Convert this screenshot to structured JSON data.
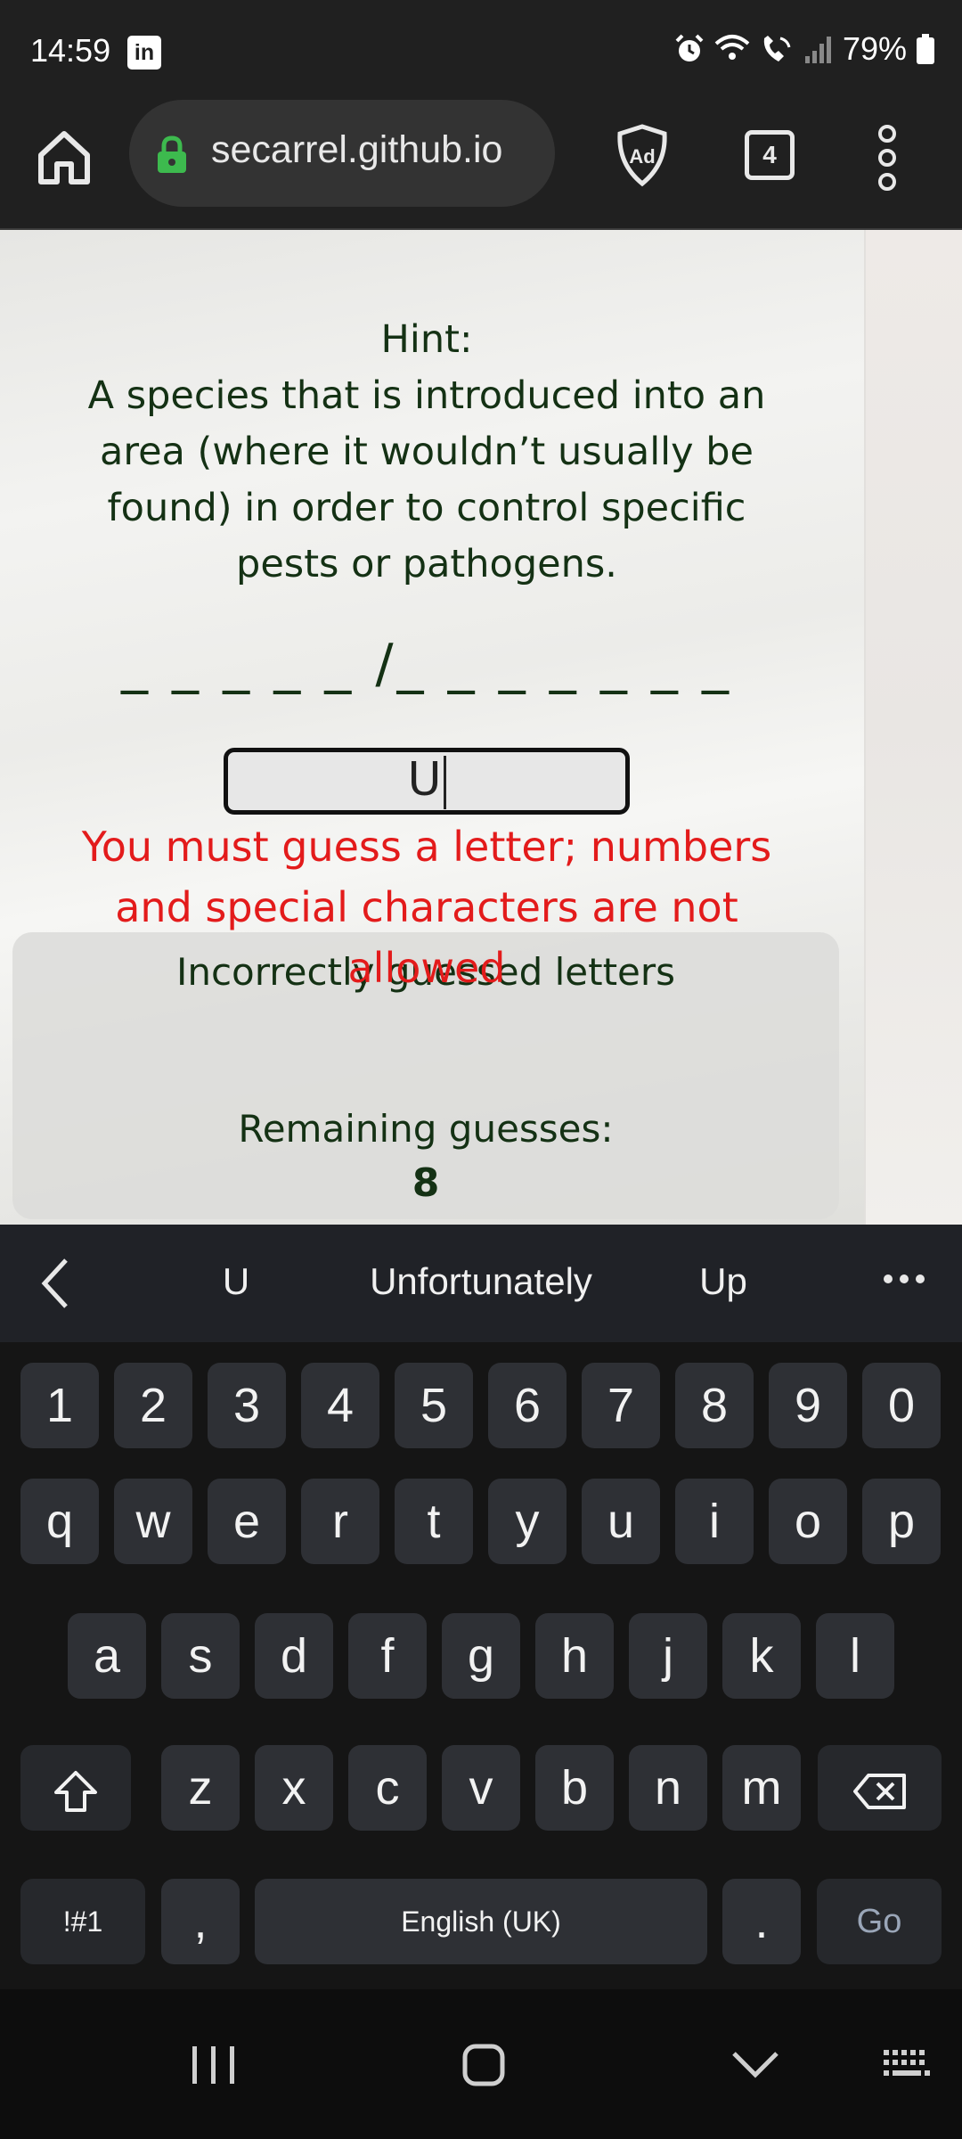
{
  "status_bar": {
    "time": "14:59",
    "battery": "79%",
    "icons": [
      "linkedin-icon",
      "alarm-icon",
      "wifi-icon",
      "wifi-calling-icon",
      "signal-icon",
      "battery-icon"
    ]
  },
  "browser": {
    "url": "secarrel.github.io",
    "tab_count": "4",
    "icons": [
      "home-icon",
      "lock-icon",
      "ad-block-icon",
      "tabs-icon",
      "more-vert-icon"
    ]
  },
  "game": {
    "hint_title": "Hint:",
    "hint_lines": [
      "A species that is introduced into an",
      "area (where it wouldn’t usually be",
      "found) in order to control specific",
      "pests or pathogens."
    ],
    "word_blanks": "_ _ _ _ _ /_ _ _ _ _ _ _",
    "input_value": "U",
    "error_lines": [
      "You must guess a letter; numbers",
      "and special characters are not",
      "allowed"
    ],
    "incorrect_label": "Incorrectly guessed letters",
    "remaining_label": "Remaining guesses:",
    "remaining_value": "8"
  },
  "keyboard": {
    "suggestions": [
      "U",
      "Unfortunately",
      "Up"
    ],
    "number_row": [
      "1",
      "2",
      "3",
      "4",
      "5",
      "6",
      "7",
      "8",
      "9",
      "0"
    ],
    "row1": [
      "q",
      "w",
      "e",
      "r",
      "t",
      "y",
      "u",
      "i",
      "o",
      "p"
    ],
    "row2": [
      "a",
      "s",
      "d",
      "f",
      "g",
      "h",
      "j",
      "k",
      "l"
    ],
    "row3": [
      "z",
      "x",
      "c",
      "v",
      "b",
      "n",
      "m"
    ],
    "symbols_key": "!#1",
    "comma_key": ",",
    "space_key": "English (UK)",
    "period_key": ".",
    "go_key": "Go"
  },
  "colors": {
    "text_green": "#143114",
    "error_red": "#e31b1b",
    "lock_green": "#3dba4e"
  }
}
